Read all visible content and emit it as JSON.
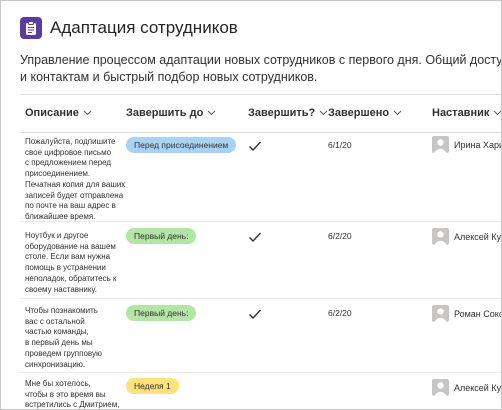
{
  "app": {
    "title": "Адаптация сотрудников",
    "description_lines": [
      "Управление процессом адаптации новых сотрудников с первого дня. Общий доступ к ресурсам",
      "и контактам и быстрый подбор новых сотрудников."
    ],
    "accent_color": "#5c3d9e"
  },
  "columns": [
    {
      "label": "Описание",
      "chevron": true
    },
    {
      "label": "Завершить до",
      "chevron": true
    },
    {
      "label": "Завершить?",
      "chevron": true
    },
    {
      "label": "Завершено",
      "chevron": true
    },
    {
      "label": "Наставник",
      "chevron": true
    }
  ],
  "rows": [
    {
      "description_lines": [
        "Пожалуйста, подпишите",
        "свое цифровое письмо",
        "с предложением перед",
        "присоединением.",
        "Печатная копия для ваших",
        "записей будет отправлена",
        "по почте на ваш адрес в",
        "ближайшее время."
      ],
      "due": "Перед присоединением",
      "due_color": "#a9d3f5",
      "completed": true,
      "completed_on": "6/1/20",
      "mentor": "Ирина Хари"
    },
    {
      "description_lines": [
        "Ноутбук и другое",
        "оборудование на вашем",
        "столе. Если вам нужна",
        "помощь в устранении",
        "неполадок, обратитесь к",
        "своему наставнику."
      ],
      "due": "Первый день:",
      "due_color": "#b3e6a6",
      "completed": true,
      "completed_on": "6/2/20",
      "mentor": "Алексей Кул"
    },
    {
      "description_lines": [
        "Чтобы познакомить",
        "вас с остальной",
        "частью команды,",
        "в первый день мы",
        "проведем групповую",
        "синхронизацию."
      ],
      "due": "Первый день:",
      "due_color": "#b3e6a6",
      "completed": true,
      "completed_on": "6/2/20",
      "mentor": "Роман Соко"
    },
    {
      "description_lines": [
        "Мне бы хотелось,",
        "чтобы в это время вы",
        "встретились с Дмитрием,"
      ],
      "due": "Неделя 1",
      "due_color": "#fde27d",
      "completed": false,
      "completed_on": "",
      "mentor": "Алексей Кул"
    }
  ]
}
